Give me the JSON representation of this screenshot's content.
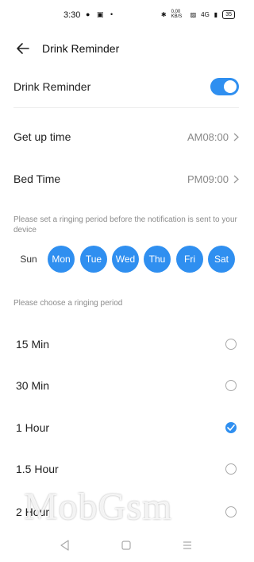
{
  "status_bar": {
    "time": "3:30",
    "left_icons": "● ▣ •",
    "speed": "0.00 KB/S",
    "network": "4G",
    "battery": "35"
  },
  "header": {
    "title": "Drink Reminder"
  },
  "reminder": {
    "label": "Drink Reminder",
    "enabled": true
  },
  "times": {
    "getup_label": "Get up time",
    "getup_value": "AM08:00",
    "bed_label": "Bed Time",
    "bed_value": "PM09:00"
  },
  "period_hint": "Please set a ringing period before the notification is sent to your device",
  "days": [
    {
      "label": "Sun",
      "selected": false
    },
    {
      "label": "Mon",
      "selected": true
    },
    {
      "label": "Tue",
      "selected": true
    },
    {
      "label": "Wed",
      "selected": true
    },
    {
      "label": "Thu",
      "selected": true
    },
    {
      "label": "Fri",
      "selected": true
    },
    {
      "label": "Sat",
      "selected": true
    }
  ],
  "interval_hint": "Please choose a ringing period",
  "intervals": [
    {
      "label": "15 Min",
      "selected": false
    },
    {
      "label": "30 Min",
      "selected": false
    },
    {
      "label": "1 Hour",
      "selected": true
    },
    {
      "label": "1.5 Hour",
      "selected": false
    },
    {
      "label": "2 Hour",
      "selected": false
    }
  ],
  "watermark": "MobGsm",
  "colors": {
    "accent": "#2f8ff0",
    "secondary_text": "#888888"
  }
}
